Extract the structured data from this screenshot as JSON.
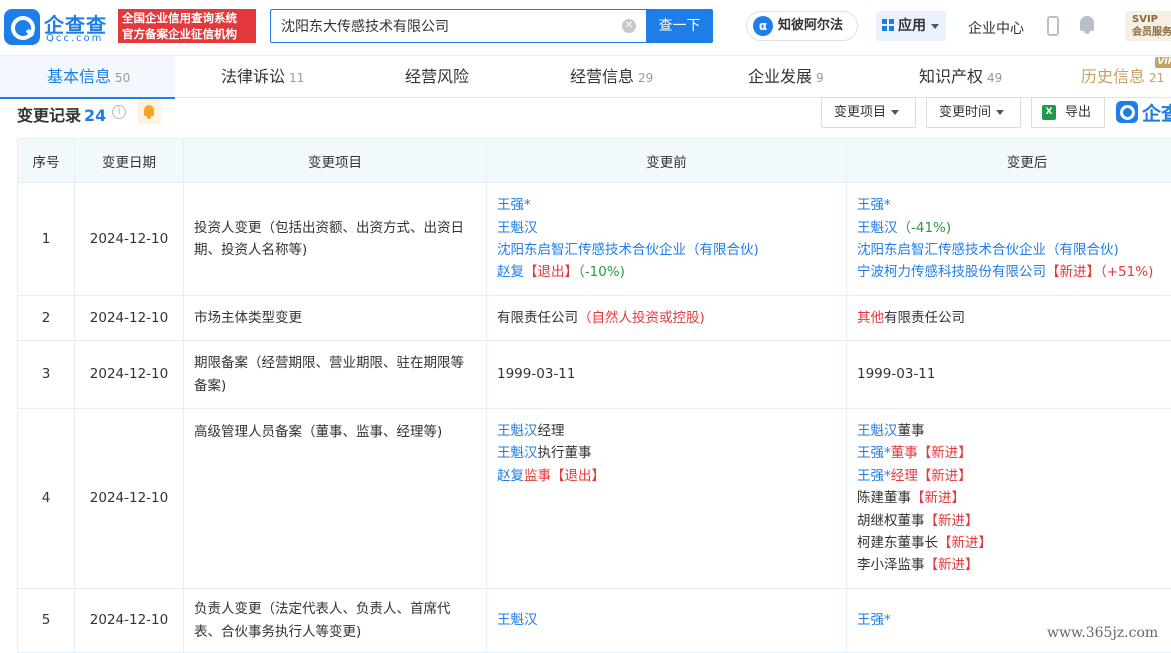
{
  "header": {
    "logo_cn": "企查查",
    "logo_en": "Qcc.com",
    "slogan_line1": "全国企业信用查询系统",
    "slogan_line2": "官方备案企业征信机构",
    "search_value": "沈阳东大传感技术有限公司",
    "search_button": "查一下",
    "alpha_label": "知彼阿尔法",
    "apps_label": "应用",
    "enterprise_center": "企业中心",
    "svip_line1": "SVIP",
    "svip_line2": "会员服务"
  },
  "tabs": [
    {
      "label": "基本信息",
      "count": "50",
      "active": true
    },
    {
      "label": "法律诉讼",
      "count": "11"
    },
    {
      "label": "经营风险",
      "count": ""
    },
    {
      "label": "经营信息",
      "count": "29"
    },
    {
      "label": "企业发展",
      "count": "9"
    },
    {
      "label": "知识产权",
      "count": "49"
    },
    {
      "label": "历史信息",
      "count": "21",
      "vip": "VIP"
    }
  ],
  "section": {
    "title": "变更记录",
    "count": "24",
    "filter_item": "变更项目",
    "filter_time": "变更时间",
    "export": "导出",
    "brand_text": "企查"
  },
  "table": {
    "headers": [
      "序号",
      "变更日期",
      "变更项目",
      "变更前",
      "变更后"
    ],
    "rows": [
      {
        "no": "1",
        "date": "2024-12-10",
        "item": "投资人变更（包括出资额、出资方式、出资日期、投资人名称等)",
        "before": [
          [
            {
              "t": "王强*",
              "c": "blue"
            }
          ],
          [
            {
              "t": "王魁汉",
              "c": "blue"
            }
          ],
          [
            {
              "t": "沈阳东启智汇传感技术合伙企业（有限合伙)",
              "c": "blue"
            }
          ],
          [
            {
              "t": "赵复",
              "c": "blue"
            },
            {
              "t": "【退出】",
              "c": "red"
            },
            {
              "t": "（-10%)",
              "c": "green"
            }
          ]
        ],
        "after": [
          [
            {
              "t": "王强*",
              "c": "blue"
            }
          ],
          [
            {
              "t": "王魁汉",
              "c": "blue"
            },
            {
              "t": "（-41%)",
              "c": "green"
            }
          ],
          [
            {
              "t": "沈阳东启智汇传感技术合伙企业（有限合伙)",
              "c": "blue"
            }
          ],
          [
            {
              "t": "宁波柯力传感科技股份有限公司",
              "c": "blue"
            },
            {
              "t": "【新进】",
              "c": "red"
            },
            {
              "t": "（+51%)",
              "c": "red"
            }
          ]
        ]
      },
      {
        "no": "2",
        "date": "2024-12-10",
        "item": "市场主体类型变更",
        "before": [
          [
            {
              "t": "有限责任公司",
              "c": ""
            },
            {
              "t": "（自然人投资或控股)",
              "c": "red"
            }
          ]
        ],
        "after": [
          [
            {
              "t": "其他",
              "c": "red"
            },
            {
              "t": "有限责任公司",
              "c": ""
            }
          ]
        ]
      },
      {
        "no": "3",
        "date": "2024-12-10",
        "item": "期限备案（经营期限、营业期限、驻在期限等备案)",
        "before": [
          [
            {
              "t": "1999-03-11",
              "c": ""
            }
          ]
        ],
        "after": [
          [
            {
              "t": "1999-03-11",
              "c": ""
            }
          ]
        ]
      },
      {
        "no": "4",
        "date": "2024-12-10",
        "item": "高级管理人员备案（董事、监事、经理等)",
        "before": [
          [
            {
              "t": "王魁汉",
              "c": "blue"
            },
            {
              "t": "经理",
              "c": ""
            }
          ],
          [
            {
              "t": "王魁汉",
              "c": "blue"
            },
            {
              "t": "执行董事",
              "c": ""
            }
          ],
          [
            {
              "t": "赵复",
              "c": "blue"
            },
            {
              "t": "监事",
              "c": "red"
            },
            {
              "t": "【退出】",
              "c": "red"
            }
          ]
        ],
        "after": [
          [
            {
              "t": "王魁汉",
              "c": "blue"
            },
            {
              "t": "董事",
              "c": ""
            }
          ],
          [
            {
              "t": "王强*",
              "c": "blue"
            },
            {
              "t": "董事",
              "c": "red"
            },
            {
              "t": "【新进】",
              "c": "red"
            }
          ],
          [
            {
              "t": "王强*",
              "c": "blue"
            },
            {
              "t": "经理",
              "c": "red"
            },
            {
              "t": "【新进】",
              "c": "red"
            }
          ],
          [
            {
              "t": "陈建董事",
              "c": ""
            },
            {
              "t": "【新进】",
              "c": "red"
            }
          ],
          [
            {
              "t": "胡继权董事",
              "c": ""
            },
            {
              "t": "【新进】",
              "c": "red"
            }
          ],
          [
            {
              "t": "柯建东董事长",
              "c": ""
            },
            {
              "t": "【新进】",
              "c": "red"
            }
          ],
          [
            {
              "t": "李小泽监事",
              "c": ""
            },
            {
              "t": "【新进】",
              "c": "red"
            }
          ]
        ]
      },
      {
        "no": "5",
        "date": "2024-12-10",
        "item": "负责人变更（法定代表人、负责人、首席代表、合伙事务执行人等变更)",
        "before": [
          [
            {
              "t": "王魁汉",
              "c": "blue"
            }
          ]
        ],
        "after": [
          [
            {
              "t": "王强*",
              "c": "blue"
            }
          ]
        ]
      }
    ]
  },
  "watermark": "www.365jz.com",
  "colors": {
    "accent": "#1e7ee8",
    "red": "#e4393c",
    "green": "#2c9a3c",
    "gold": "#c9a063"
  }
}
